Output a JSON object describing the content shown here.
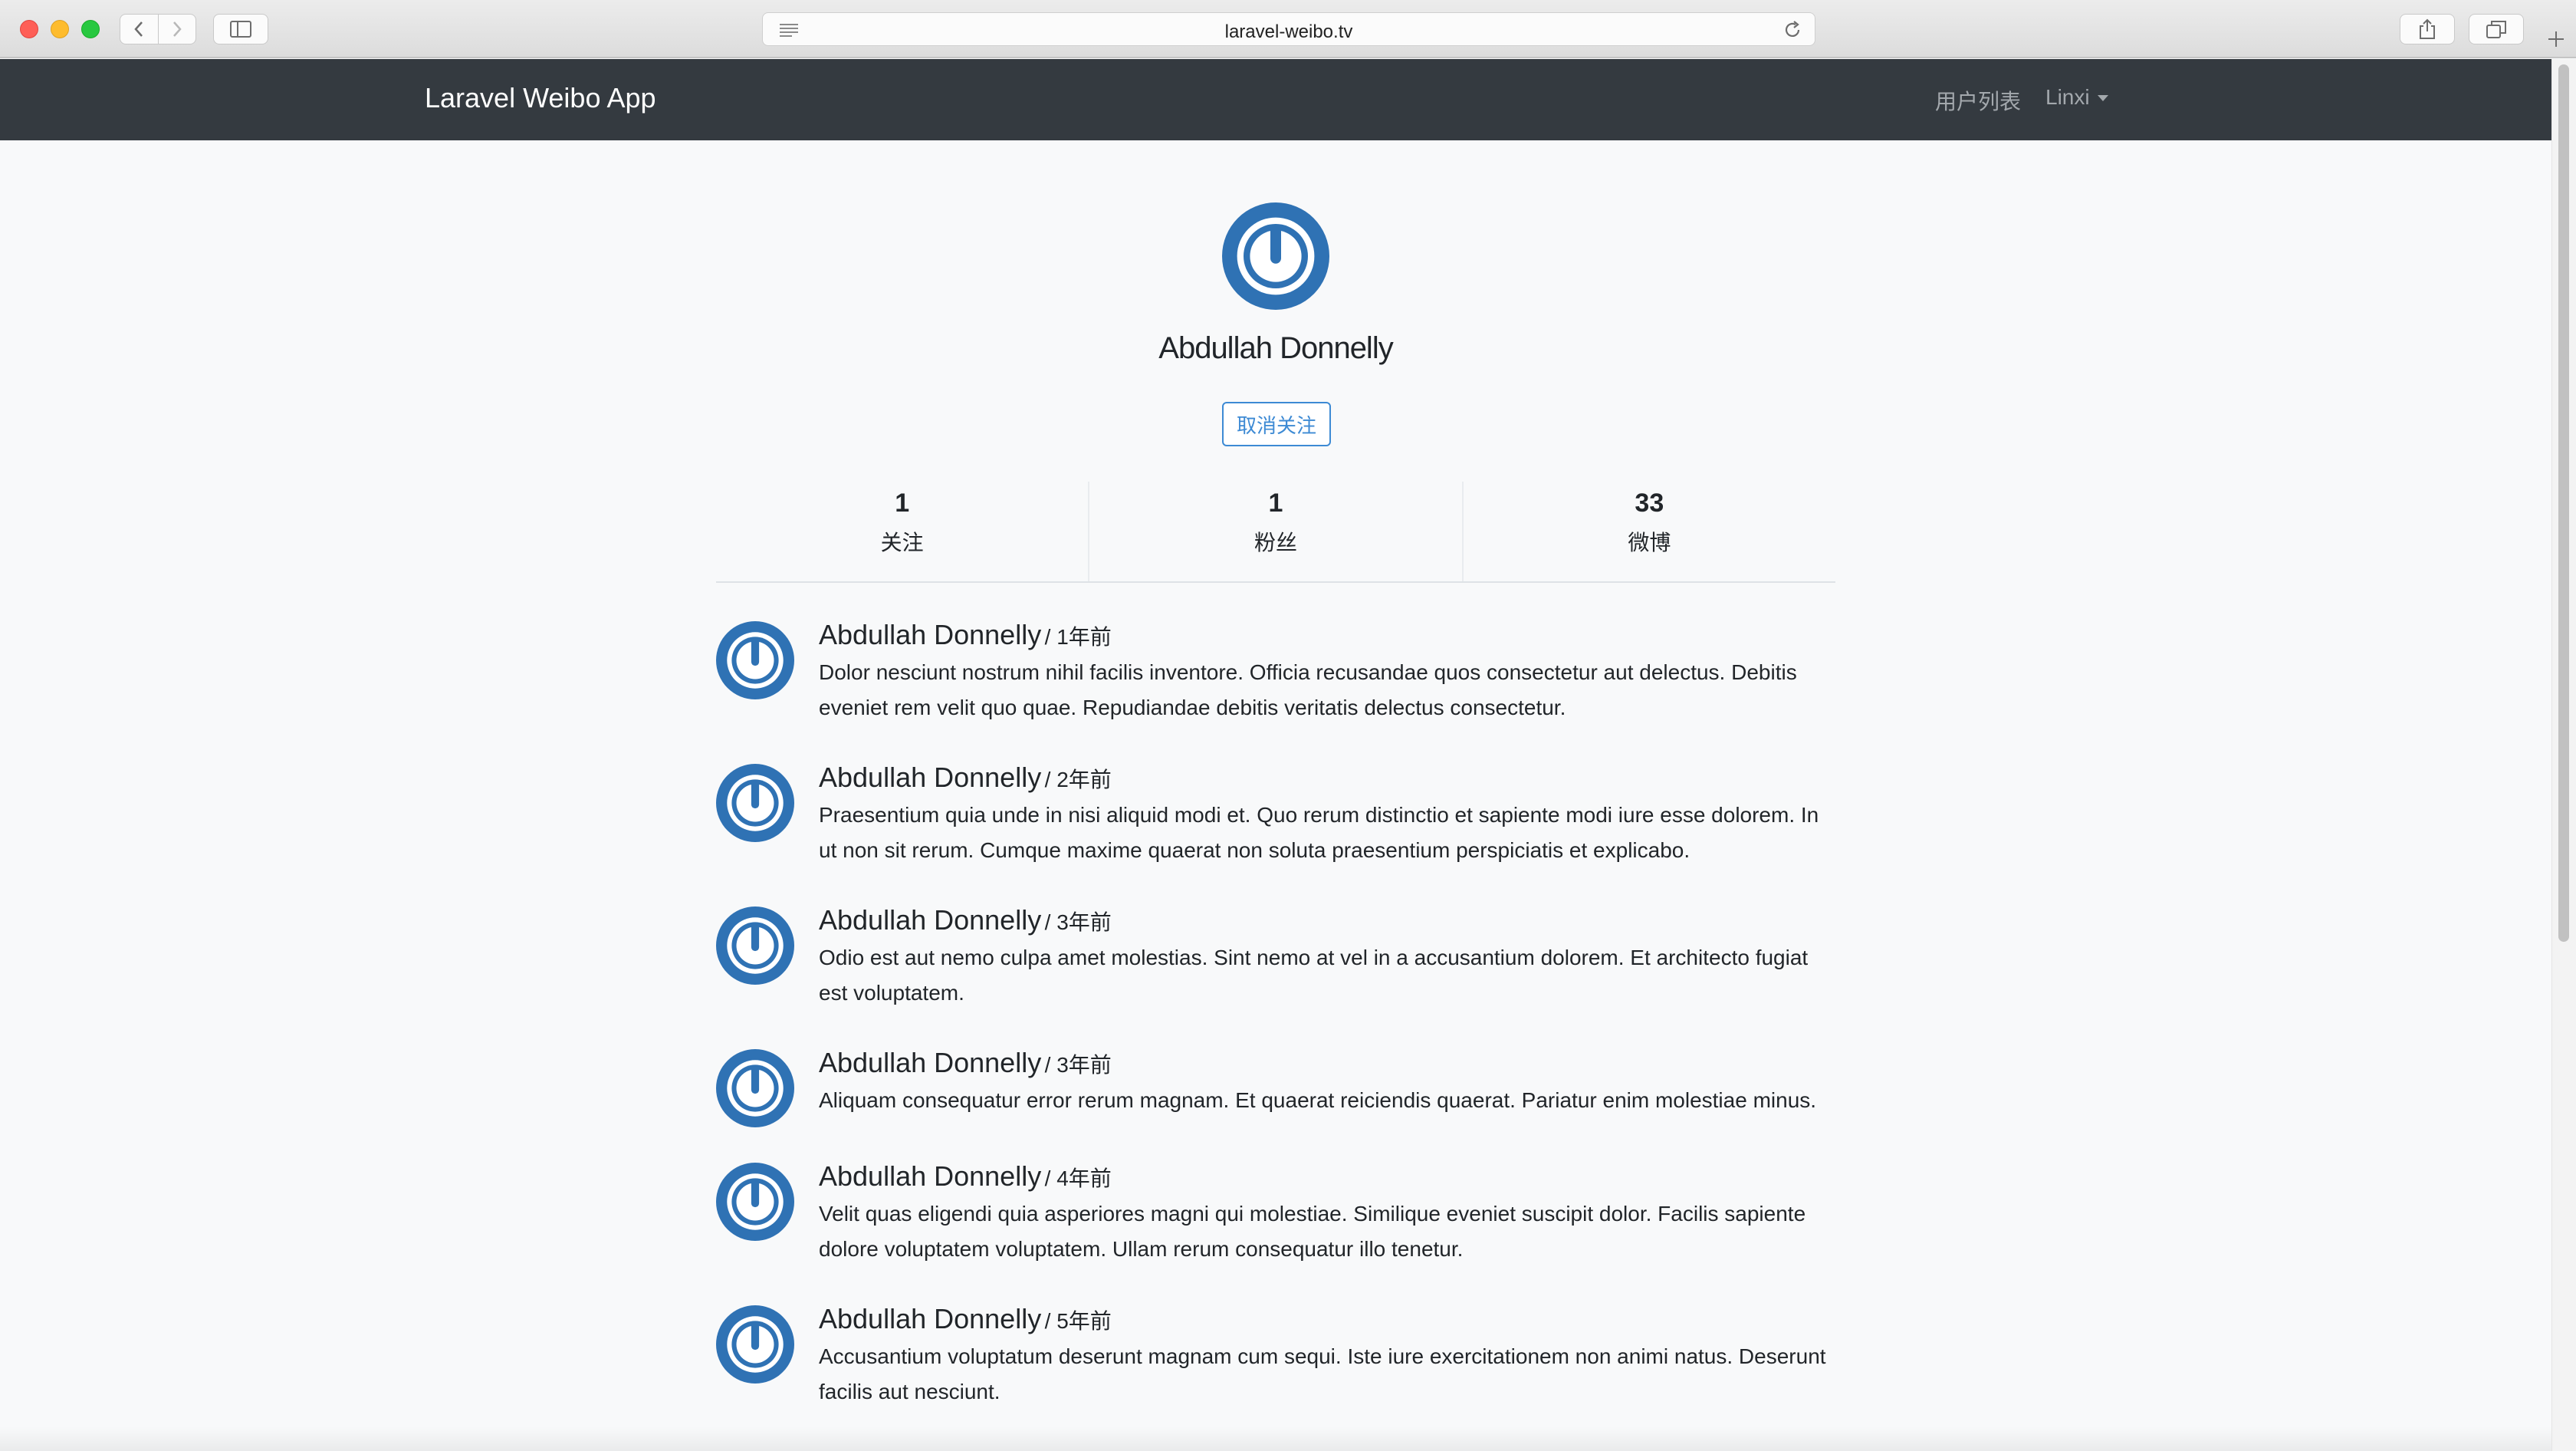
{
  "browser": {
    "url": "laravel-weibo.tv"
  },
  "navbar": {
    "brand": "Laravel Weibo App",
    "users_link": "用户列表",
    "current_user": "Linxi"
  },
  "profile": {
    "name": "Abdullah Donnelly",
    "unfollow_label": "取消关注",
    "stats": [
      {
        "value": "1",
        "label": "关注"
      },
      {
        "value": "1",
        "label": "粉丝"
      },
      {
        "value": "33",
        "label": "微博"
      }
    ]
  },
  "statuses": [
    {
      "author": "Abdullah Donnelly",
      "time": "/ 1年前",
      "content": "Dolor nesciunt nostrum nihil facilis inventore. Officia recusandae quos consectetur aut delectus. Debitis eveniet rem velit quo quae. Repudiandae debitis veritatis delectus consectetur."
    },
    {
      "author": "Abdullah Donnelly",
      "time": "/ 2年前",
      "content": "Praesentium quia unde in nisi aliquid modi et. Quo rerum distinctio et sapiente modi iure esse dolorem. In ut non sit rerum. Cumque maxime quaerat non soluta praesentium perspiciatis et explicabo."
    },
    {
      "author": "Abdullah Donnelly",
      "time": "/ 3年前",
      "content": "Odio est aut nemo culpa amet molestias. Sint nemo at vel in a accusantium dolorem. Et architecto fugiat est voluptatem."
    },
    {
      "author": "Abdullah Donnelly",
      "time": "/ 3年前",
      "content": "Aliquam consequatur error rerum magnam. Et quaerat reiciendis quaerat. Pariatur enim molestiae minus."
    },
    {
      "author": "Abdullah Donnelly",
      "time": "/ 4年前",
      "content": "Velit quas eligendi quia asperiores magni qui molestiae. Similique eveniet suscipit dolor. Facilis sapiente dolore voluptatem voluptatem. Ullam rerum consequatur illo tenetur."
    },
    {
      "author": "Abdullah Donnelly",
      "time": "/ 5年前",
      "content": "Accusantium voluptatum deserunt magnam cum sequi. Iste iure exercitationem non animi natus. Deserunt facilis aut nesciunt."
    }
  ],
  "colors": {
    "navbar_bg": "#343a40",
    "page_bg": "#f8f9fa",
    "avatar_blue": "#2f72b4",
    "button_accent": "#3d8ad4"
  }
}
